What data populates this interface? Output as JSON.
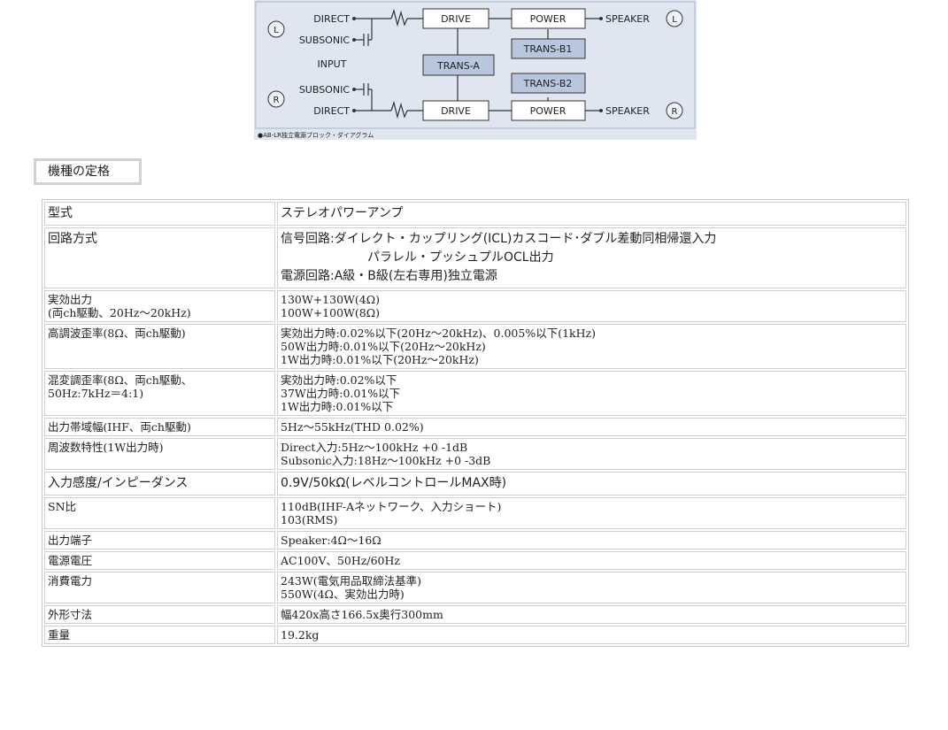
{
  "diagram": {
    "left_channel": "L",
    "right_channel": "R",
    "direct": "DIRECT",
    "subsonic": "SUBSONIC",
    "input": "INPUT",
    "drive": "DRIVE",
    "power": "POWER",
    "speaker": "SPEAKER",
    "trans_a": "TRANS-A",
    "trans_b1": "TRANS-B1",
    "trans_b2": "TRANS-B2",
    "caption": "●AB-LR独立電源ブロック・ダイアグラム",
    "colors": {
      "background": "#dfe6ef",
      "box_fill": "#b8c6de",
      "line": "#333333"
    }
  },
  "section": {
    "title": "機種の定格"
  },
  "specs": [
    {
      "label": [
        "型式"
      ],
      "value": [
        "ステレオパワーアンプ"
      ],
      "large": true
    },
    {
      "label": [
        "回路方式"
      ],
      "value": [
        "信号回路:ダイレクト・カップリング(ICL)カスコード･ダブル差動同相帰還入力",
        "パラレル・プッシュプルOCL出力",
        "電源回路:A級・B級(左右専用)独立電源"
      ],
      "large": true
    },
    {
      "label": [
        "実効出力",
        "(両ch駆動、20Hz～20kHz)"
      ],
      "value": [
        "130W+130W(4Ω)",
        "100W+100W(8Ω)"
      ]
    },
    {
      "label": [
        "高調波歪率(8Ω、両ch駆動)"
      ],
      "value": [
        "実効出力時:0.02%以下(20Hz～20kHz)、0.005%以下(1kHz)",
        "50W出力時:0.01%以下(20Hz～20kHz)",
        "1W出力時:0.01%以下(20Hz～20kHz)"
      ]
    },
    {
      "label": [
        "混変調歪率(8Ω、両ch駆動、",
        "50Hz:7kHz＝4:1)"
      ],
      "value": [
        "実効出力時:0.02%以下",
        "37W出力時:0.01%以下",
        "1W出力時:0.01%以下"
      ]
    },
    {
      "label": [
        "出力帯域幅(IHF、両ch駆動)"
      ],
      "value": [
        "5Hz～55kHz(THD 0.02%)"
      ]
    },
    {
      "label": [
        "周波数特性(1W出力時)"
      ],
      "value": [
        "Direct入力:5Hz～100kHz +0 -1dB",
        "Subsonic入力:18Hz～100kHz +0 -3dB"
      ]
    },
    {
      "label": [
        "入力感度/インピーダンス"
      ],
      "value": [
        "0.9V/50kΩ(レベルコントロールMAX時)"
      ],
      "large": true
    },
    {
      "label": [
        "SN比"
      ],
      "value": [
        "110dB(IHF-Aネットワーク、入力ショート)",
        "103(RMS)"
      ]
    },
    {
      "label": [
        "出力端子"
      ],
      "value": [
        "Speaker:4Ω～16Ω"
      ]
    },
    {
      "label": [
        "電源電圧"
      ],
      "value": [
        "AC100V、50Hz/60Hz"
      ]
    },
    {
      "label": [
        "消費電力"
      ],
      "value": [
        "243W(電気用品取締法基準)",
        "550W(4Ω、実効出力時)"
      ]
    },
    {
      "label": [
        "外形寸法"
      ],
      "value": [
        "幅420x高さ166.5x奥行300mm"
      ]
    },
    {
      "label": [
        "重量"
      ],
      "value": [
        "19.2kg"
      ]
    }
  ]
}
